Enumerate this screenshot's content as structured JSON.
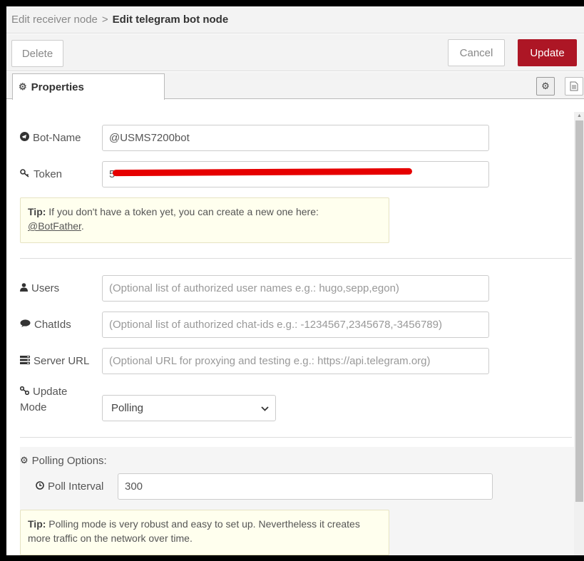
{
  "breadcrumb": {
    "parent": "Edit receiver node",
    "separator": ">",
    "current": "Edit telegram bot node"
  },
  "toolbar": {
    "delete_label": "Delete",
    "cancel_label": "Cancel",
    "update_label": "Update"
  },
  "tabs": {
    "properties_label": "Properties"
  },
  "fields": {
    "bot_name": {
      "label": "Bot-Name",
      "value": "@USMS7200bot"
    },
    "token": {
      "label": "Token",
      "value": "5"
    },
    "users": {
      "label": "Users",
      "placeholder": "(Optional list of authorized user names e.g.: hugo,sepp,egon)"
    },
    "chatids": {
      "label": "ChatIds",
      "placeholder": "(Optional list of authorized chat-ids e.g.: -1234567,2345678,-3456789)"
    },
    "server_url": {
      "label": "Server URL",
      "placeholder": "(Optional URL for proxying and testing e.g.: https://api.telegram.org)"
    },
    "update_mode": {
      "label_line1": "Update",
      "label_line2": "Mode",
      "value": "Polling"
    },
    "polling_options": {
      "label": "Polling Options:"
    },
    "poll_interval": {
      "label": "Poll Interval",
      "value": "300"
    }
  },
  "tips": {
    "token_tip": {
      "prefix": "Tip:",
      "text": " If you don't have a token yet, you can create a new one here:",
      "link": "@BotFather",
      "suffix": "."
    },
    "polling_tip": {
      "prefix": "Tip:",
      "text": " Polling mode is very robust and easy to set up. Nevertheless it creates more traffic on the network over time."
    }
  },
  "icons": {
    "tab_gear": "gear-icon",
    "bot_name": "telegram-icon",
    "token": "key-icon",
    "users": "user-icon",
    "chatids": "comment-icon",
    "server_url": "server-icon",
    "update_mode": "link-icon",
    "polling_options": "cogs-icon",
    "poll_interval": "clock-icon"
  },
  "colors": {
    "update_button": "#ad1625",
    "tip_background": "#ffffee",
    "redaction": "#e60000"
  }
}
